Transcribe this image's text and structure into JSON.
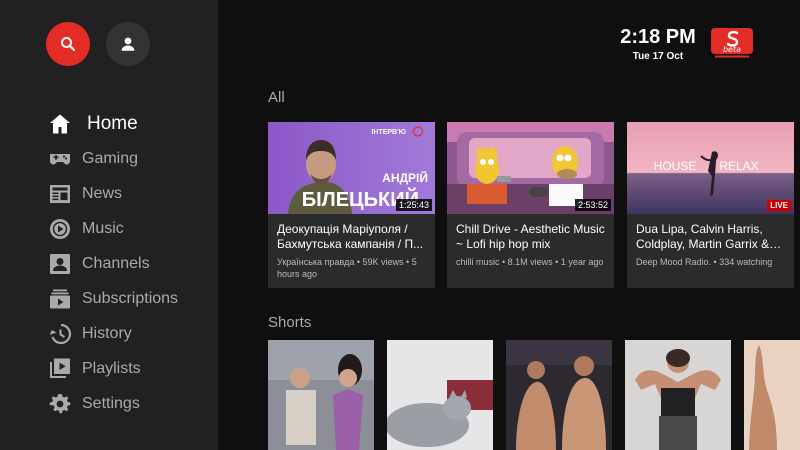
{
  "header": {
    "time": "2:18 PM",
    "date": "Tue 17 Oct",
    "logo_text": "beta"
  },
  "sidebar": {
    "items": [
      {
        "label": "Home",
        "icon": "home-icon",
        "active": true
      },
      {
        "label": "Gaming",
        "icon": "gaming-icon"
      },
      {
        "label": "News",
        "icon": "news-icon"
      },
      {
        "label": "Music",
        "icon": "music-icon"
      },
      {
        "label": "Channels",
        "icon": "channels-icon"
      },
      {
        "label": "Subscriptions",
        "icon": "subscriptions-icon"
      },
      {
        "label": "History",
        "icon": "history-icon"
      },
      {
        "label": "Playlists",
        "icon": "playlists-icon"
      },
      {
        "label": "Settings",
        "icon": "settings-icon"
      }
    ]
  },
  "sections": {
    "all_title": "All",
    "shorts_title": "Shorts"
  },
  "videos": [
    {
      "title": "Деокупація Маріуполя / Бахмутська кампанія / П...",
      "sub": "Українська правда • 59K views • 5 hours ago",
      "duration": "1:25:43",
      "thumb_text_1": "АНДРІЙ",
      "thumb_text_2": "БІЛЕЦЬКИЙ",
      "thumb_tag": "ІНТЕРВ'Ю"
    },
    {
      "title": "Chill Drive - Aesthetic Music ~ Lofi hip hop mix",
      "sub": "chilli music • 8.1M views • 1 year ago",
      "duration": "2:53:52"
    },
    {
      "title": "Dua Lipa, Calvin Harris, Coldplay, Martin Garrix & K...",
      "sub": "Deep Mood Radio. • 334 watching",
      "badge": "LIVE",
      "thumb_text_1": "HOUSE",
      "thumb_text_2": "RELAX"
    }
  ],
  "colors": {
    "accent": "#e52d27",
    "sidebar_bg": "#212121",
    "page_bg": "#0f0f0f"
  }
}
